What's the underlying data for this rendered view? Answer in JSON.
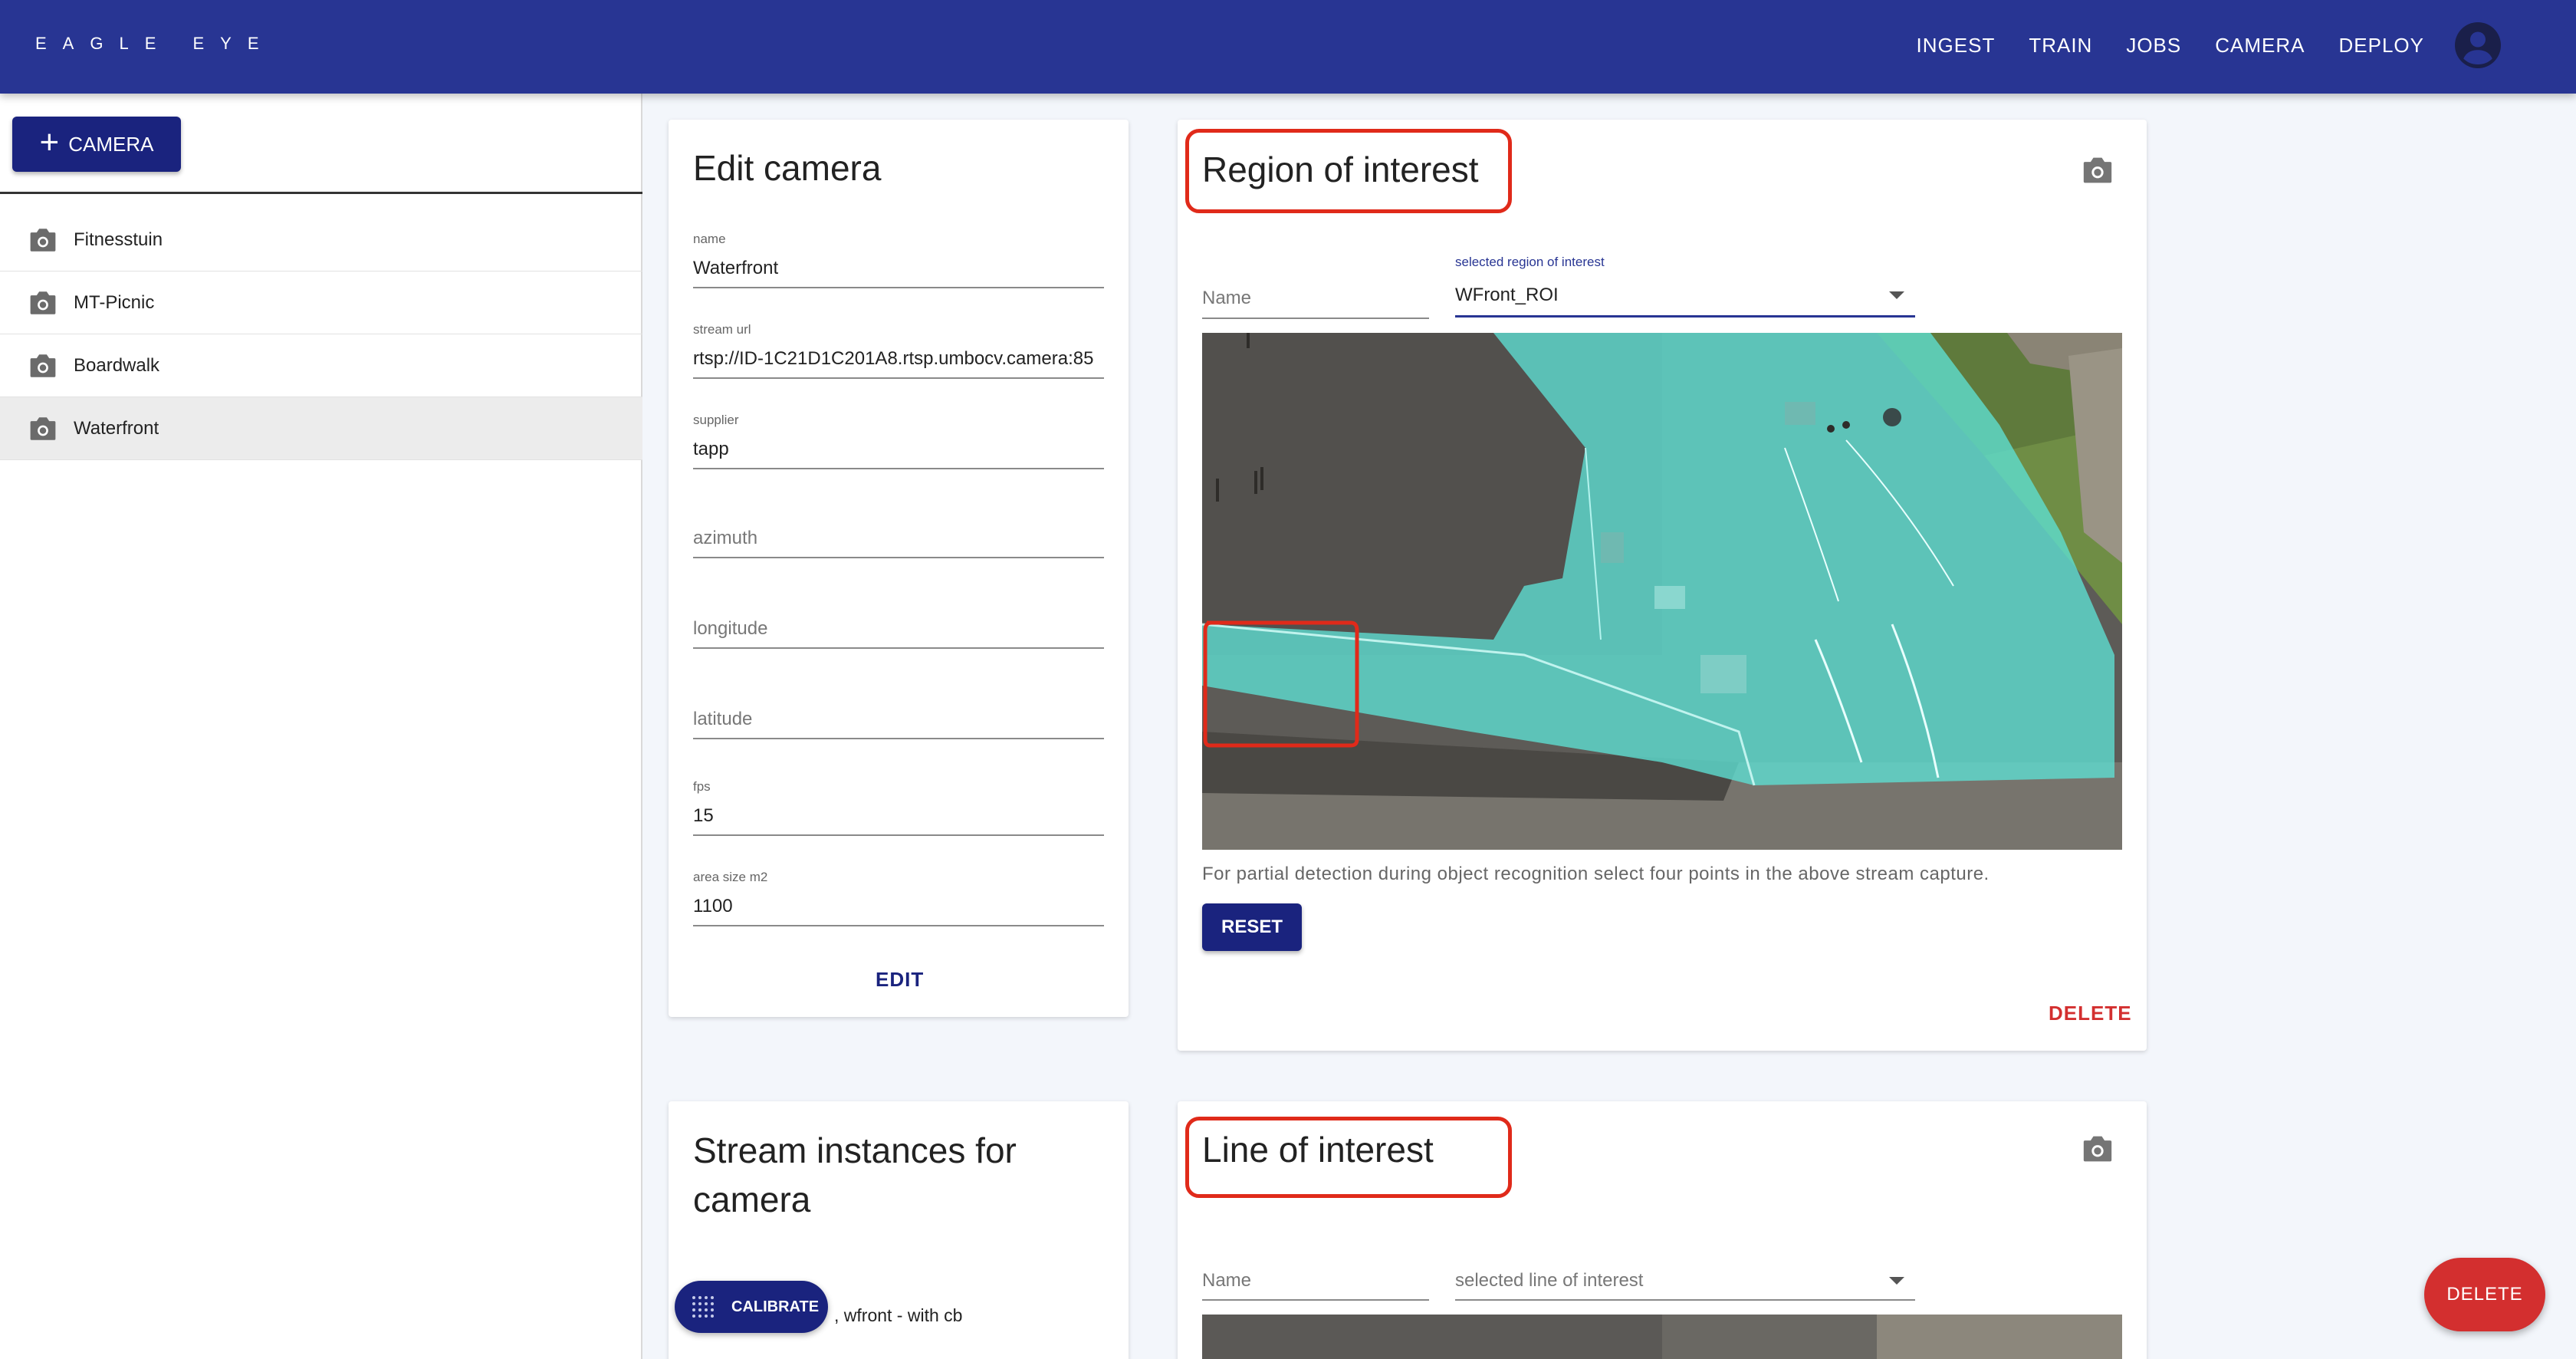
{
  "app": {
    "brand": "EAGLE EYE"
  },
  "nav": {
    "items": [
      "INGEST",
      "TRAIN",
      "JOBS",
      "CAMERA",
      "DEPLOY"
    ],
    "account_icon": "account-circle-icon"
  },
  "sidebar": {
    "add_button_label": "CAMERA",
    "cameras": [
      {
        "label": "Fitnesstuin",
        "icon": "camera-icon",
        "selected": false
      },
      {
        "label": "MT-Picnic",
        "icon": "camera-icon",
        "selected": false
      },
      {
        "label": "Boardwalk",
        "icon": "camera-icon",
        "selected": false
      },
      {
        "label": "Waterfront",
        "icon": "camera-icon",
        "selected": true
      }
    ]
  },
  "edit_camera": {
    "title": "Edit camera",
    "fields": {
      "name": {
        "label": "name",
        "value": "Waterfront"
      },
      "stream_url": {
        "label": "stream url",
        "value": "rtsp://ID-1C21D1C201A8.rtsp.umbocv.camera:85"
      },
      "supplier": {
        "label": "supplier",
        "value": "tapp"
      },
      "azimuth": {
        "placeholder": "azimuth"
      },
      "longitude": {
        "placeholder": "longitude"
      },
      "latitude": {
        "placeholder": "latitude"
      },
      "fps": {
        "label": "fps",
        "value": "15"
      },
      "area_size": {
        "label": "area size m2",
        "value": "1100"
      }
    },
    "edit_label": "EDIT"
  },
  "roi": {
    "title": "Region of interest",
    "name_placeholder": "Name",
    "select_label": "selected region of interest",
    "select_value": "WFront_ROI",
    "note": "For partial detection during object recognition select four points in the above stream capture.",
    "reset_label": "RESET",
    "delete_label": "DELETE",
    "overlay_color": "#5ee0d4"
  },
  "stream_instances": {
    "title": "Stream instances for camera",
    "first_item": ", wfront - with cb"
  },
  "loi": {
    "title": "Line of interest",
    "name_placeholder": "Name",
    "select_placeholder": "selected line of interest"
  },
  "calibrate": {
    "label": "CALIBRATE"
  },
  "fab": {
    "delete_label": "DELETE"
  },
  "colors": {
    "primary": "#283593",
    "button": "#1a237e",
    "danger": "#d32f2f",
    "annotation": "#e02a1a"
  }
}
